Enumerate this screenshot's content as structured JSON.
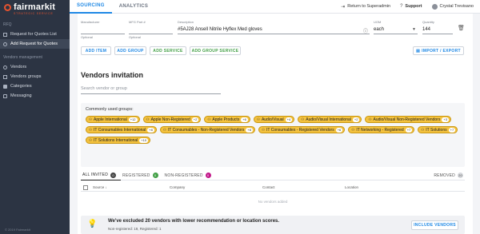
{
  "brand": {
    "name": "fairmarkit",
    "tagline": "STRATEGIC SERVICE",
    "accent": "#e8532f"
  },
  "sidebar": {
    "sections": [
      {
        "title": "RFQ",
        "items": [
          {
            "label": "Request for Quotes List",
            "icon": "list-icon"
          },
          {
            "label": "Add Request for Quotes",
            "icon": "add-icon"
          }
        ]
      },
      {
        "title": "Vendors management",
        "items": [
          {
            "label": "Vendors",
            "icon": "vendors-icon"
          },
          {
            "label": "Vendors groups",
            "icon": "groups-icon"
          },
          {
            "label": "Categories",
            "icon": "categories-icon"
          },
          {
            "label": "Messaging",
            "icon": "messaging-icon"
          }
        ]
      }
    ],
    "copyright": "© 2019 Fairmarkit"
  },
  "topbar": {
    "tabs": [
      "SOURCING",
      "ANALYTICS"
    ],
    "return_label": "Return to Superadmin",
    "support_label": "Support",
    "user_name": "Crystal Trevisano"
  },
  "item_row": {
    "manufacturer": {
      "label": "Manufacturer",
      "value": "",
      "hint": "Optional"
    },
    "mfg_part": {
      "label": "MFG Part #",
      "value": "",
      "hint": "Optional"
    },
    "description": {
      "label": "Description",
      "value": "#5AJ28 Ansell Nitrile Hyflex Med gloves"
    },
    "uom": {
      "label": "UOM",
      "value": "each"
    },
    "quantity": {
      "label": "Quantity",
      "value": "144"
    }
  },
  "actions": {
    "add_item": "ADD ITEM",
    "add_group": "ADD GROUP",
    "add_service": "ADD SERVICE",
    "add_group_service": "ADD GROUP SERVICE",
    "import_export": "IMPORT / EXPORT"
  },
  "vendors_invitation": {
    "title": "Vendors invitation",
    "search_placeholder": "Search vendor or group",
    "groups_title": "Commonly used groups:",
    "groups": [
      {
        "label": "Apple International",
        "count": "+12"
      },
      {
        "label": "Apple Non-Registered",
        "count": "+2"
      },
      {
        "label": "Apple Products",
        "count": "+6"
      },
      {
        "label": "Audio/Visual",
        "count": "+4"
      },
      {
        "label": "Audio/Visual International",
        "count": "+2"
      },
      {
        "label": "Audio/Visual Non-Registered Vendors",
        "count": "+3"
      },
      {
        "label": "IT Consumables International",
        "count": "+8"
      },
      {
        "label": "IT Consumables - Non-Registered Vendors",
        "count": "+8"
      },
      {
        "label": "IT Consumables - Registered Vendors",
        "count": "+6"
      },
      {
        "label": "IT Networking - Registered",
        "count": "+7"
      },
      {
        "label": "IT Solutions",
        "count": "+7"
      },
      {
        "label": "IT Solutions International",
        "count": "+10"
      }
    ],
    "tabs": [
      {
        "label": "ALL INVITED",
        "count": "0"
      },
      {
        "label": "REGISTERED",
        "count": "0"
      },
      {
        "label": "NON-REGISTERED",
        "count": "0"
      }
    ],
    "removed": {
      "label": "REMOVED",
      "count": "20"
    },
    "columns": [
      "Source",
      "Company",
      "Contact",
      "Location"
    ],
    "empty_text": "No vendors added",
    "notice_title": "We've excluded 20 vendors with lower recommendation or location scores.",
    "notice_sub": "Non-registered: 19, Registered: 1",
    "include_label": "INCLUDE VENDORS"
  }
}
